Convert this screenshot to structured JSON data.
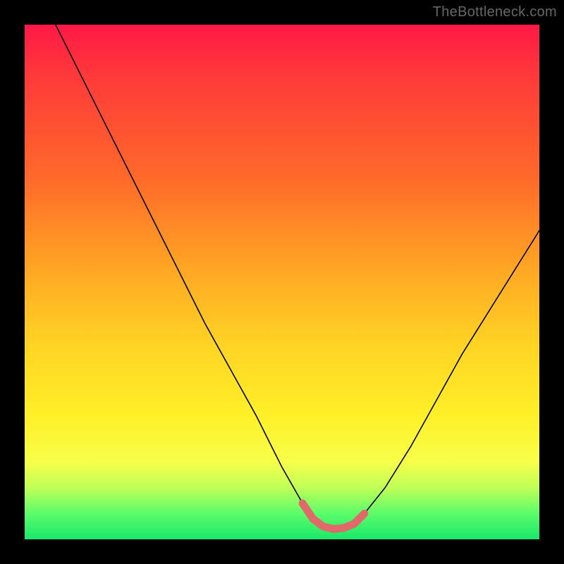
{
  "watermark": {
    "text": "TheBottleneck.com"
  },
  "chart_data": {
    "type": "line",
    "title": "",
    "xlabel": "",
    "ylabel": "",
    "xlim": [
      0,
      100
    ],
    "ylim": [
      0,
      100
    ],
    "x": [
      6,
      10,
      15,
      20,
      25,
      30,
      35,
      40,
      45,
      50,
      54,
      56,
      58,
      60,
      62,
      64,
      66,
      70,
      75,
      80,
      85,
      90,
      95,
      100
    ],
    "values": [
      100,
      92,
      82,
      72,
      62,
      52,
      42,
      33,
      24,
      14,
      7,
      4,
      2.5,
      2,
      2.2,
      3,
      5,
      10,
      18,
      27,
      36,
      44,
      52,
      60
    ],
    "highlight": {
      "x_start": 54,
      "x_end": 66,
      "y": 2.3
    }
  }
}
